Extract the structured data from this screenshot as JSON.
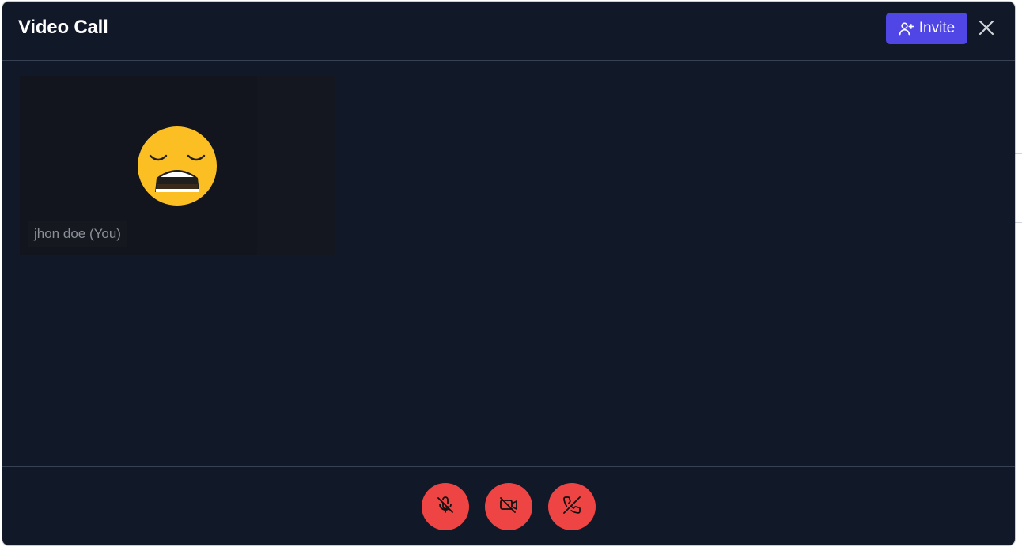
{
  "window": {
    "title": "Video Call"
  },
  "header": {
    "invite_label": "Invite",
    "invite_icon": "user-plus-icon",
    "close_icon": "close-icon"
  },
  "participants": [
    {
      "name": "jhon doe (You)",
      "avatar": "tired-face-emoji",
      "is_self": true
    }
  ],
  "controls": [
    {
      "icon": "mic-off-icon",
      "state": "muted"
    },
    {
      "icon": "video-off-icon",
      "state": "off"
    },
    {
      "icon": "phone-off-icon",
      "state": "end"
    }
  ],
  "colors": {
    "modal_bg": "#111827",
    "divider": "#374151",
    "invite_bg": "#4f46e5",
    "control_bg": "#ef4444",
    "emoji_face": "#fbbf24"
  }
}
